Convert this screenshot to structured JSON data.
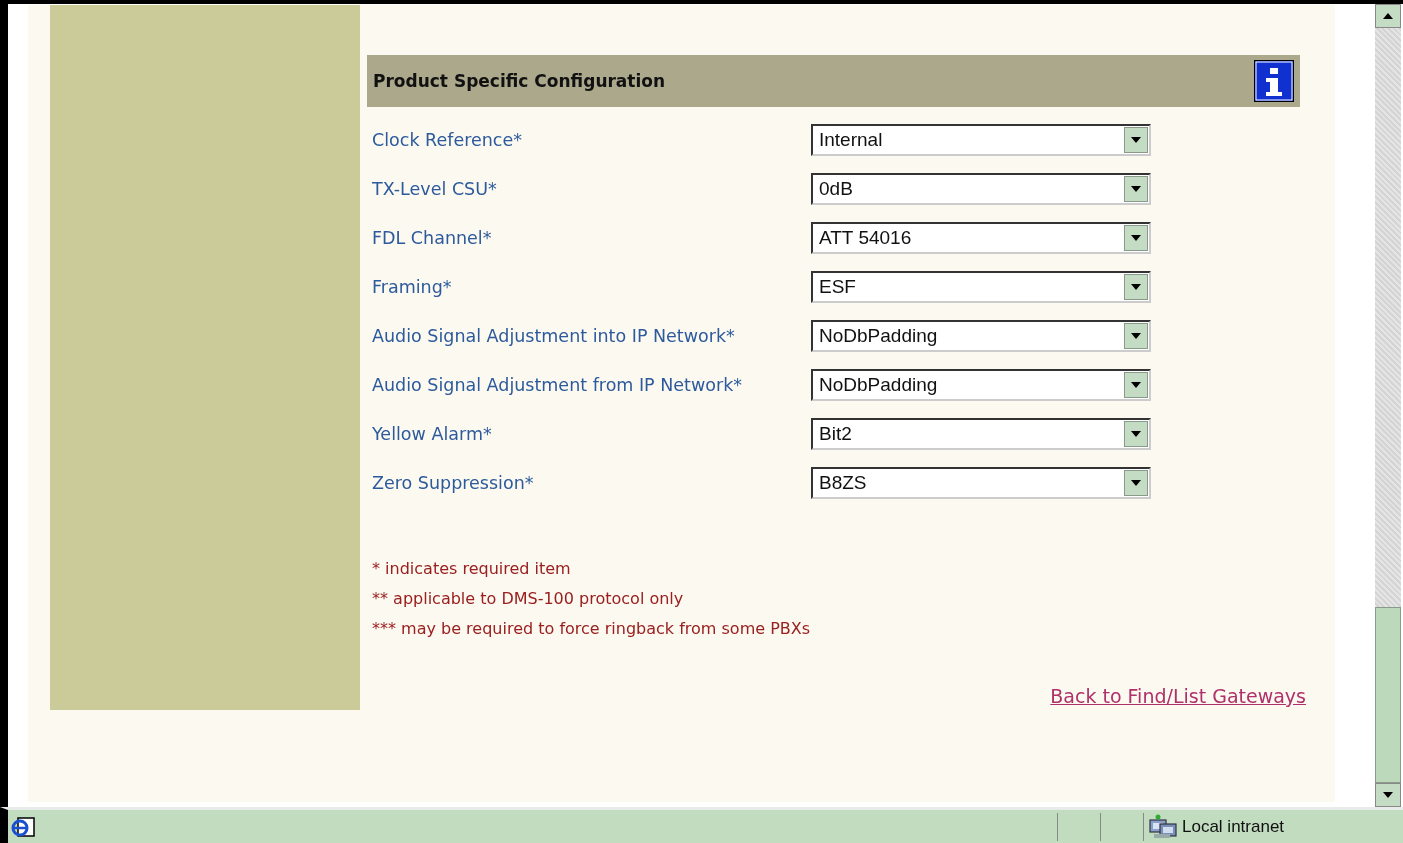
{
  "section": {
    "title": "Product Specific Configuration"
  },
  "fields": [
    {
      "label": "Clock Reference*",
      "value": "Internal"
    },
    {
      "label": "TX-Level CSU*",
      "value": "0dB"
    },
    {
      "label": "FDL Channel*",
      "value": "ATT 54016"
    },
    {
      "label": "Framing*",
      "value": "ESF"
    },
    {
      "label": "Audio Signal Adjustment into IP Network*",
      "value": "NoDbPadding"
    },
    {
      "label": "Audio Signal Adjustment from IP Network*",
      "value": "NoDbPadding"
    },
    {
      "label": "Yellow Alarm*",
      "value": "Bit2"
    },
    {
      "label": "Zero Suppression*",
      "value": "B8ZS"
    }
  ],
  "notes": [
    "* indicates required item",
    "** applicable to DMS-100 protocol only",
    "*** may be required to force ringback from some PBXs"
  ],
  "back_link": "Back to Find/List Gateways",
  "status_bar": {
    "zone": "Local intranet"
  }
}
